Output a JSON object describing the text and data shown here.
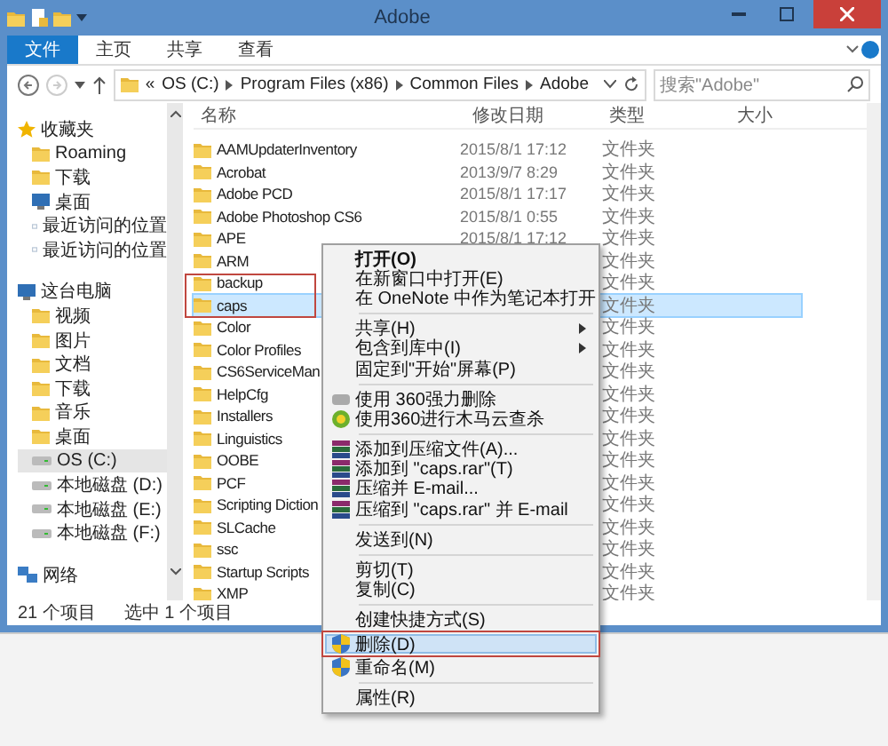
{
  "window": {
    "title": "Adobe"
  },
  "ribbon_tabs": [
    {
      "label": "文件",
      "selected": true
    },
    {
      "label": "主页",
      "selected": false
    },
    {
      "label": "共享",
      "selected": false
    },
    {
      "label": "查看",
      "selected": false
    }
  ],
  "address": {
    "overflow": "«",
    "segments": [
      "OS (C:)",
      "Program Files (x86)",
      "Common Files",
      "Adobe"
    ]
  },
  "search": {
    "placeholder": "搜索\"Adobe\""
  },
  "nav": [
    {
      "label": "收藏夹",
      "kind": "star",
      "selected": false,
      "children": [
        {
          "label": "Roaming",
          "kind": "folder",
          "selected": false
        },
        {
          "label": "下载",
          "kind": "folder",
          "selected": false
        },
        {
          "label": "桌面",
          "kind": "desktop",
          "selected": false
        },
        {
          "label": "最近访问的位置",
          "kind": "recent",
          "selected": false
        },
        {
          "label": "最近访问的位置",
          "kind": "recent",
          "selected": false
        }
      ]
    },
    {
      "label": "这台电脑",
      "kind": "pc",
      "selected": false,
      "children": [
        {
          "label": "视频",
          "kind": "folder",
          "selected": false
        },
        {
          "label": "图片",
          "kind": "folder",
          "selected": false
        },
        {
          "label": "文档",
          "kind": "folder",
          "selected": false
        },
        {
          "label": "下载",
          "kind": "folder",
          "selected": false
        },
        {
          "label": "音乐",
          "kind": "folder",
          "selected": false
        },
        {
          "label": "桌面",
          "kind": "folder",
          "selected": false
        },
        {
          "label": "OS (C:)",
          "kind": "drive",
          "selected": true
        },
        {
          "label": "本地磁盘 (D:)",
          "kind": "drive",
          "selected": false
        },
        {
          "label": "本地磁盘 (E:)",
          "kind": "drive",
          "selected": false
        },
        {
          "label": "本地磁盘 (F:)",
          "kind": "drive",
          "selected": false
        }
      ]
    },
    {
      "label": "网络",
      "kind": "network",
      "selected": false
    }
  ],
  "columns": [
    "名称",
    "修改日期",
    "类型",
    "大小"
  ],
  "files": [
    {
      "name": "AAMUpdaterInventory",
      "date": "2015/8/1 17:12",
      "type": "文件夹",
      "selected": false
    },
    {
      "name": "Acrobat",
      "date": "2013/9/7 8:29",
      "type": "文件夹",
      "selected": false
    },
    {
      "name": "Adobe PCD",
      "date": "2015/8/1 17:17",
      "type": "文件夹",
      "selected": false
    },
    {
      "name": "Adobe Photoshop CS6",
      "date": "2015/8/1 0:55",
      "type": "文件夹",
      "selected": false
    },
    {
      "name": "APE",
      "date": "2015/8/1 17:12",
      "type": "文件夹",
      "selected": false
    },
    {
      "name": "ARM",
      "type": "文件夹",
      "selected": false
    },
    {
      "name": "backup",
      "type": "文件夹",
      "selected": false
    },
    {
      "name": "caps",
      "type": "文件夹",
      "selected": true
    },
    {
      "name": "Color",
      "type": "文件夹",
      "selected": false
    },
    {
      "name": "Color Profiles",
      "type": "文件夹",
      "selected": false
    },
    {
      "name": "CS6ServiceMan",
      "type": "文件夹",
      "selected": false
    },
    {
      "name": "HelpCfg",
      "type": "文件夹",
      "selected": false
    },
    {
      "name": "Installers",
      "type": "文件夹",
      "selected": false
    },
    {
      "name": "Linguistics",
      "type": "文件夹",
      "selected": false
    },
    {
      "name": "OOBE",
      "type": "文件夹",
      "selected": false
    },
    {
      "name": "PCF",
      "type": "文件夹",
      "selected": false
    },
    {
      "name": "Scripting Diction",
      "type": "文件夹",
      "selected": false
    },
    {
      "name": "SLCache",
      "type": "文件夹",
      "selected": false
    },
    {
      "name": "ssc",
      "type": "文件夹",
      "selected": false
    },
    {
      "name": "Startup Scripts",
      "type": "文件夹",
      "selected": false
    },
    {
      "name": "XMP",
      "type": "文件夹",
      "selected": false
    }
  ],
  "status_bar": [
    "21 个项目",
    "选中 1 个项目"
  ],
  "context_menu": [
    {
      "kind": "plain",
      "label": "打开(O)",
      "bold": true,
      "selected": false
    },
    {
      "kind": "plain",
      "label": "在新窗口中打开(E)",
      "selected": false
    },
    {
      "kind": "plain",
      "label": "在 OneNote 中作为笔记本打开",
      "selected": false
    },
    {
      "kind": "separator"
    },
    {
      "kind": "plain",
      "label": "共享(H)",
      "submenu": true,
      "selected": false
    },
    {
      "kind": "plain",
      "label": "包含到库中(I)",
      "submenu": true,
      "selected": false
    },
    {
      "kind": "plain",
      "label": "固定到\"开始\"屏幕(P)",
      "selected": false
    },
    {
      "kind": "separator"
    },
    {
      "kind": "eraser",
      "label": "使用 360强力删除",
      "selected": false
    },
    {
      "kind": "scan",
      "label": "使用360进行木马云查杀",
      "selected": false
    },
    {
      "kind": "separator"
    },
    {
      "kind": "archive",
      "label": "添加到压缩文件(A)...",
      "selected": false
    },
    {
      "kind": "archive",
      "label": "添加到 \"caps.rar\"(T)",
      "selected": false
    },
    {
      "kind": "archive",
      "label": "压缩并 E-mail...",
      "selected": false
    },
    {
      "kind": "archive",
      "label": "压缩到 \"caps.rar\" 并 E-mail",
      "selected": false
    },
    {
      "kind": "separator"
    },
    {
      "kind": "plain",
      "label": "发送到(N)",
      "selected": false
    },
    {
      "kind": "separator"
    },
    {
      "kind": "plain",
      "label": "剪切(T)",
      "selected": false
    },
    {
      "kind": "plain",
      "label": "复制(C)",
      "selected": false
    },
    {
      "kind": "separator"
    },
    {
      "kind": "plain",
      "label": "创建快捷方式(S)",
      "selected": false
    },
    {
      "kind": "shield",
      "label": "删除(D)",
      "selected": true,
      "annotated": true
    },
    {
      "kind": "shield",
      "label": "重命名(M)",
      "selected": false
    },
    {
      "kind": "separator"
    },
    {
      "kind": "plain",
      "label": "属性(R)",
      "selected": false
    }
  ]
}
